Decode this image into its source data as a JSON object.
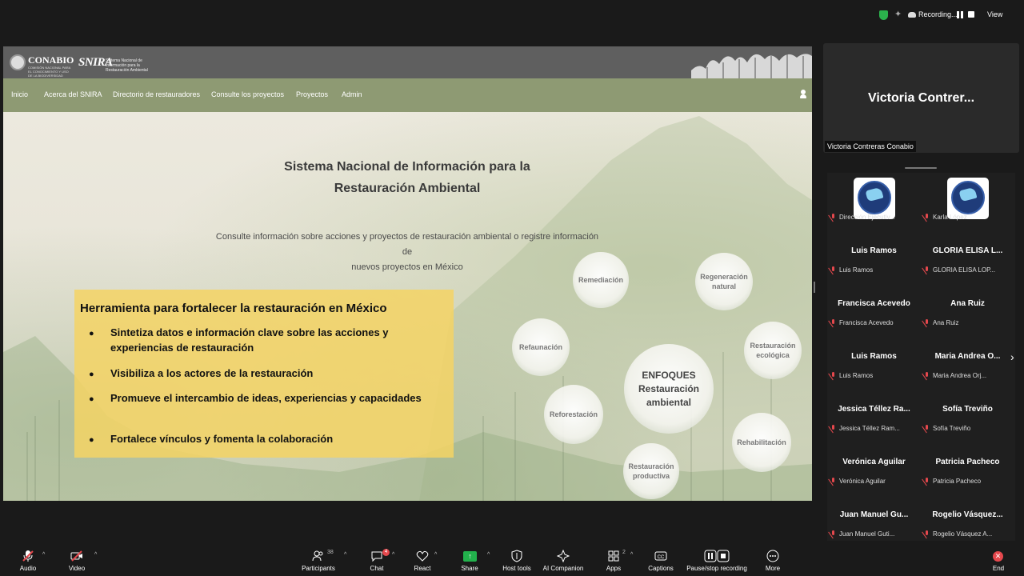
{
  "status_bar": {
    "recording_label": "Recording...",
    "view_label": "View"
  },
  "shared_site": {
    "header": {
      "org_logo_text": "CONABIO",
      "org_logo_subtext": "COMISIÓN NACIONAL PARA EL CONOCIMIENTO Y USO DE LA BIODIVERSIDAD",
      "brand": "SNIRA",
      "brand_subtext": "Sistema Nacional de Información para la Restauración Ambiental"
    },
    "nav": [
      "Inicio",
      "Acerca del SNIRA",
      "Directorio de restauradores",
      "Consulte los proyectos",
      "Proyectos",
      "Admin"
    ],
    "hero": {
      "title_line1": "Sistema Nacional de Información para la",
      "title_line2": "Restauración Ambiental",
      "subtitle_line1": "Consulte información sobre acciones y proyectos de restauración ambiental o registre información de",
      "subtitle_line2": "nuevos proyectos en México"
    },
    "tool_box": {
      "title": "Herramienta para fortalecer la restauración en México",
      "bullets": [
        "Sintetiza datos e información clave sobre las acciones y experiencias de restauración",
        "Visibiliza a los actores de la restauración",
        "Promueve el intercambio de ideas, experiencias y capacidades",
        "Fortalece vínculos y fomenta la colaboración"
      ]
    },
    "bubbles": {
      "center_line1": "ENFOQUES",
      "center_line2": "Restauración",
      "center_line3": "ambiental",
      "remediacion": "Remediación",
      "regeneracion_1": "Regeneración",
      "regeneracion_2": "natural",
      "refaunacion": "Refaunación",
      "restauracion_eco_1": "Restauración",
      "restauracion_eco_2": "ecológica",
      "reforestacion": "Reforestación",
      "rehabilitacion": "Rehabilitación",
      "restauracion_prod_1": "Restauración",
      "restauracion_prod_2": "productiva"
    }
  },
  "speaker": {
    "display_name": "Victoria  Contrer...",
    "label": "Victoria Contreras Conabio"
  },
  "participants": [
    {
      "name": "",
      "label": "Dirección Ejecutiv..."
    },
    {
      "name": "",
      "label": "Karla López"
    },
    {
      "name": "Luis Ramos",
      "label": "Luis Ramos"
    },
    {
      "name": "GLORIA ELISA L...",
      "label": "GLORIA ELISA LOP..."
    },
    {
      "name": "Francisca Acevedo",
      "label": "Francisca Acevedo"
    },
    {
      "name": "Ana Ruiz",
      "label": "Ana Ruiz"
    },
    {
      "name": "Luis Ramos",
      "label": "Luis Ramos"
    },
    {
      "name": "Maria Andrea O...",
      "label": "Maria Andrea Orj..."
    },
    {
      "name": "Jessica Téllez Ra...",
      "label": "Jessica Téllez Ram..."
    },
    {
      "name": "Sofía Treviño",
      "label": "Sofía Treviño"
    },
    {
      "name": "Verónica Aguilar",
      "label": "Verónica Aguilar"
    },
    {
      "name": "Patricia Pacheco",
      "label": "Patricia Pacheco"
    },
    {
      "name": "Juan Manuel Gu...",
      "label": "Juan Manuel Guti..."
    },
    {
      "name": "Rogelio  Vásquez...",
      "label": "Rogelio Vásquez A..."
    }
  ],
  "toolbar": {
    "audio": "Audio",
    "video": "Video",
    "participants": "Participants",
    "participants_count": "38",
    "chat": "Chat",
    "chat_badge": "4",
    "react": "React",
    "share": "Share",
    "host_tools": "Host tools",
    "ai_companion": "AI Companion",
    "apps": "Apps",
    "apps_count": "2",
    "captions": "Captions",
    "pause_stop": "Pause/stop recording",
    "more": "More",
    "end": "End"
  },
  "colors": {
    "nav_bg": "#8e9a73",
    "tool_box_bg": "#f5d464",
    "share_green": "#22b14c",
    "end_red": "#e5484d"
  }
}
